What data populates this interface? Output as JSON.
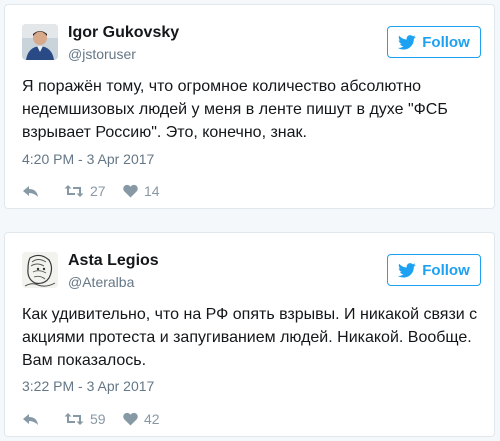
{
  "tweets": [
    {
      "name": "Igor Gukovsky",
      "handle": "@jstoruser",
      "follow_label": "Follow",
      "text": "Я поражён тому, что огромное количество абсолютно недемшизовых людей у меня в ленте пишут в духе \"ФСБ взрывает Россию\". Это, конечно, знак.",
      "timestamp": "4:20 PM - 3 Apr 2017",
      "retweets": "27",
      "likes": "14"
    },
    {
      "name": "Asta Legios",
      "handle": "@Ateralba",
      "follow_label": "Follow",
      "text": "Как удивительно, что на РФ опять взрывы. И никакой связи с акциями протеста и запугиванием людей. Никакой. Вообще. Вам показалось.",
      "timestamp": "3:22 PM - 3 Apr 2017",
      "retweets": "59",
      "likes": "42"
    }
  ],
  "colors": {
    "accent": "#1da1f2",
    "text": "#14171a",
    "muted": "#657786",
    "icon": "#8899a6",
    "border": "#e1e8ed",
    "background": "#f5f8fa"
  },
  "icons": {
    "follow": "twitter-bird-icon",
    "reply": "reply-icon",
    "retweet": "retweet-icon",
    "like": "heart-icon"
  }
}
